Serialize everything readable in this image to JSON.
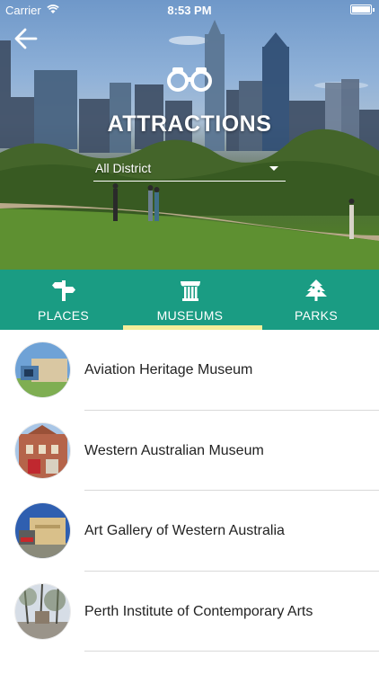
{
  "status_bar": {
    "carrier": "Carrier",
    "time": "8:53 PM"
  },
  "header": {
    "title": "ATTRACTIONS"
  },
  "filter": {
    "selected": "All District"
  },
  "tabs": [
    {
      "label": "PLACES",
      "icon": "signpost-icon"
    },
    {
      "label": "MUSEUMS",
      "icon": "column-icon",
      "active": true
    },
    {
      "label": "PARKS",
      "icon": "tree-icon"
    }
  ],
  "colors": {
    "accent": "#1a9c83",
    "tab_indicator": "#f3ee9a"
  },
  "list": {
    "items": [
      {
        "name": "Aviation Heritage Museum"
      },
      {
        "name": "Western Australian Museum"
      },
      {
        "name": "Art Gallery of Western Australia"
      },
      {
        "name": "Perth Institute of Contemporary Arts"
      }
    ]
  }
}
